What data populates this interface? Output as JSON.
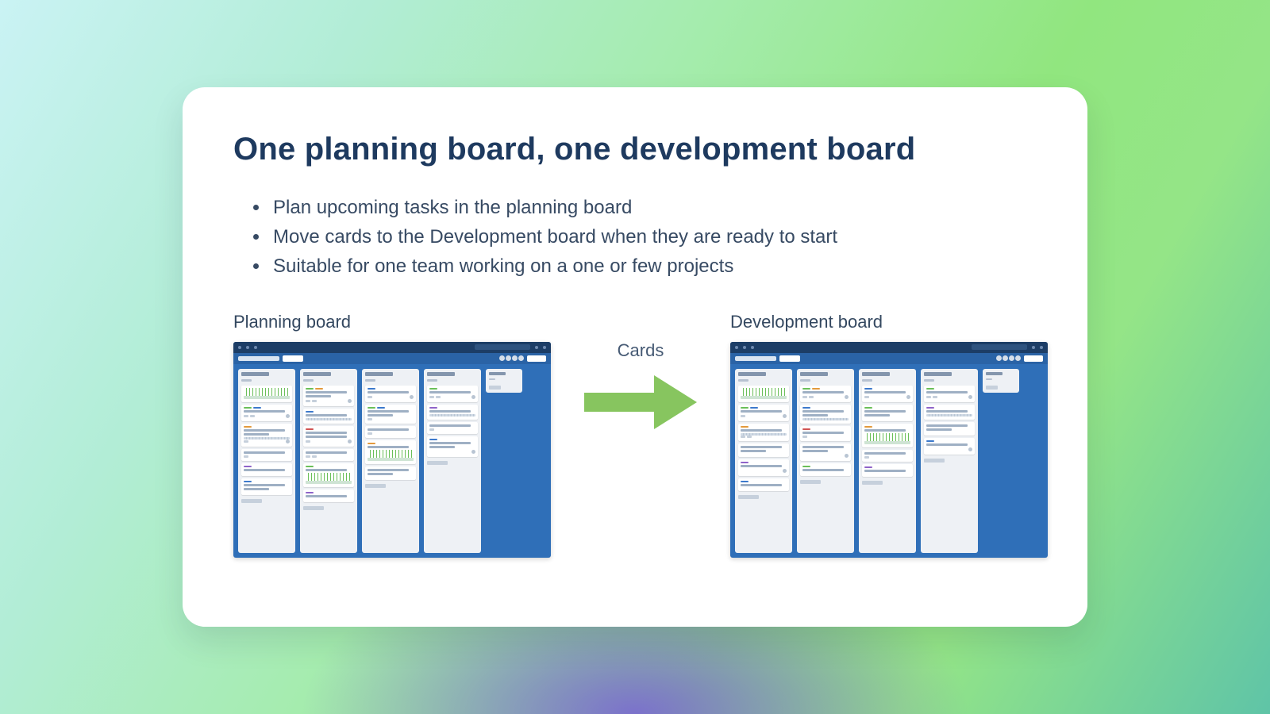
{
  "slide": {
    "title": "One planning board, one development board",
    "bullets": [
      "Plan upcoming tasks in the planning board",
      "Move cards to the Development board when they are ready to start",
      "Suitable for one team working on a one or few projects"
    ],
    "planning_label": "Planning board",
    "development_label": "Development board",
    "arrow_label": "Cards"
  },
  "colors": {
    "arrow": "#87c55f",
    "heading": "#1e3a5f",
    "body": "#374a63"
  }
}
